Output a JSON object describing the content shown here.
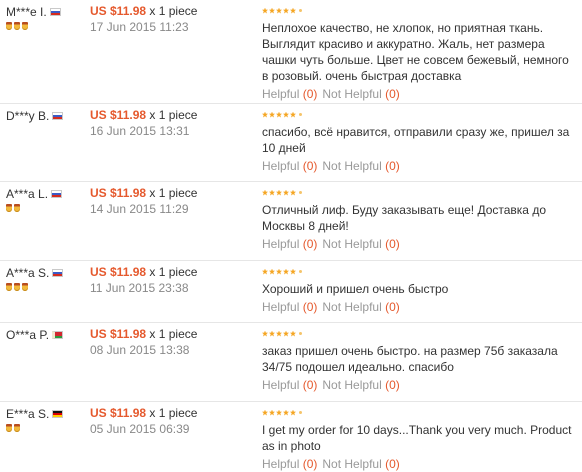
{
  "reviews": [
    {
      "buyer": "M***e I.",
      "flag": "ru",
      "medals": 3,
      "price": "US $11.98",
      "quantity": "x 1 piece",
      "date": "17 Jun 2015 11:23",
      "text": "Неплохое качество, не хлопок, но приятная ткань. Выглядит красиво и аккуратно. Жаль, нет размера чашки чуть больше. Цвет не совсем бежевый, немного в розовый. очень быстрая доставка",
      "helpful_label": "Helpful",
      "helpful_count": "(0)",
      "not_helpful_label": "Not Helpful",
      "not_helpful_count": "(0)",
      "rating": 5
    },
    {
      "buyer": "D***y B.",
      "flag": "ru",
      "medals": 0,
      "price": "US $11.98",
      "quantity": "x 1 piece",
      "date": "16 Jun 2015 13:31",
      "text": "спасибо, всё нравится, отправили сразу же, пришел за 10 дней",
      "helpful_label": "Helpful",
      "helpful_count": "(0)",
      "not_helpful_label": "Not Helpful",
      "not_helpful_count": "(0)",
      "rating": 5
    },
    {
      "buyer": "A***a L.",
      "flag": "ru",
      "medals": 2,
      "price": "US $11.98",
      "quantity": "x 1 piece",
      "date": "14 Jun 2015 11:29",
      "text": "Отличный лиф. Буду заказывать еще! Доставка до Москвы 8 дней!",
      "helpful_label": "Helpful",
      "helpful_count": "(0)",
      "not_helpful_label": "Not Helpful",
      "not_helpful_count": "(0)",
      "rating": 5
    },
    {
      "buyer": "A***a S.",
      "flag": "ru",
      "medals": 3,
      "price": "US $11.98",
      "quantity": "x 1 piece",
      "date": "11 Jun 2015 23:38",
      "text": "Хороший и пришел очень быстро",
      "helpful_label": "Helpful",
      "helpful_count": "(0)",
      "not_helpful_label": "Not Helpful",
      "not_helpful_count": "(0)",
      "rating": 5
    },
    {
      "buyer": "O***a P.",
      "flag": "by",
      "medals": 0,
      "price": "US $11.98",
      "quantity": "x 1 piece",
      "date": "08 Jun 2015 13:38",
      "text": "заказ пришел очень быстро. на размер 75б заказала 34/75 подошел идеально. спасибо",
      "helpful_label": "Helpful",
      "helpful_count": "(0)",
      "not_helpful_label": "Not Helpful",
      "not_helpful_count": "(0)",
      "rating": 5
    },
    {
      "buyer": "E***a S.",
      "flag": "de",
      "medals": 2,
      "price": "US $11.98",
      "quantity": "x 1 piece",
      "date": "05 Jun 2015 06:39",
      "text": "I get my order for 10 days...Thank you very much. Product as in photo",
      "helpful_label": "Helpful",
      "helpful_count": "(0)",
      "not_helpful_label": "Not Helpful",
      "not_helpful_count": "(0)",
      "rating": 5
    }
  ],
  "colors": {
    "price": "#e5592d",
    "date": "#888888",
    "helpful": "#999999",
    "count": "#e5592d",
    "star": "#f5a623",
    "divider": "#e6e6e6"
  }
}
